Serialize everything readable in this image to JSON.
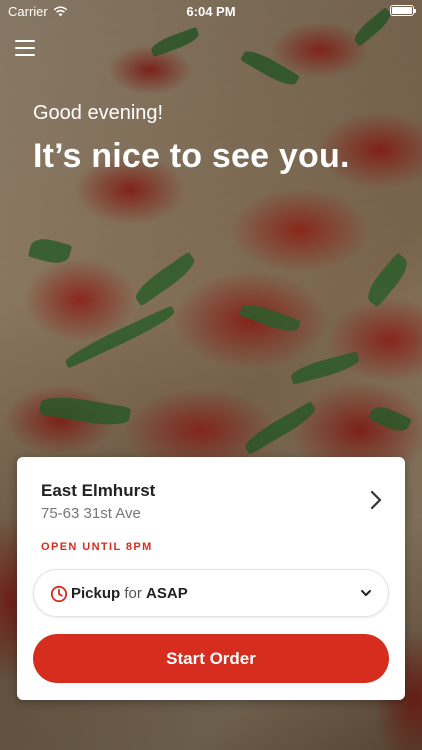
{
  "status_bar": {
    "carrier": "Carrier",
    "time": "6:04 PM",
    "battery_level": 1.0
  },
  "header": {
    "menu_icon": "hamburger-menu-icon"
  },
  "hero": {
    "greeting": "Good evening!",
    "headline": "It’s nice to see you."
  },
  "location_card": {
    "name": "East Elmhurst",
    "address": "75-63 31st Ave",
    "status": "OPEN UNTIL 8PM",
    "chevron_icon": "chevron-right-icon",
    "order_type": {
      "icon": "clock-icon",
      "mode": "Pickup",
      "connector": "for",
      "time": "ASAP",
      "dropdown_icon": "chevron-down-icon"
    },
    "start_button": "Start Order"
  },
  "colors": {
    "accent": "#d62d1e",
    "card_bg": "#ffffff",
    "status_text": "#d62d1e"
  }
}
